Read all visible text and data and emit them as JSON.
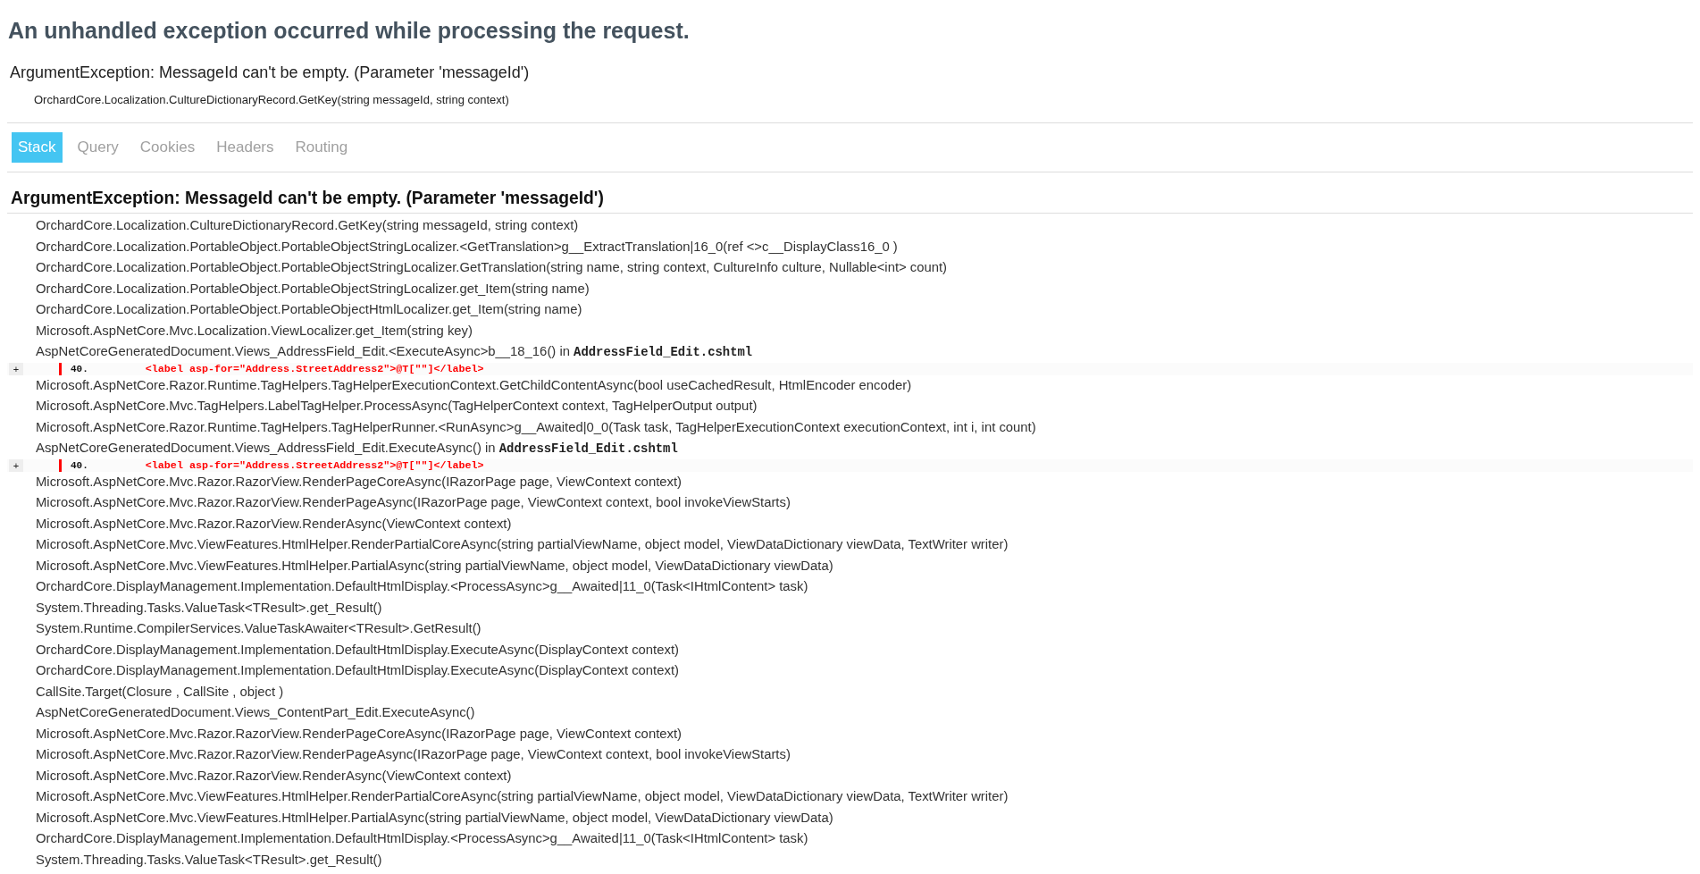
{
  "title": "An unhandled exception occurred while processing the request.",
  "error": {
    "message": "ArgumentException: MessageId can't be empty. (Parameter 'messageId')",
    "location": "OrchardCore.Localization.CultureDictionaryRecord.GetKey(string messageId, string context)"
  },
  "tabs": [
    {
      "label": "Stack",
      "selected": true
    },
    {
      "label": "Query",
      "selected": false
    },
    {
      "label": "Cookies",
      "selected": false
    },
    {
      "label": "Headers",
      "selected": false
    },
    {
      "label": "Routing",
      "selected": false
    }
  ],
  "stack": {
    "heading": "ArgumentException: MessageId can't be empty. (Parameter 'messageId')",
    "frames": [
      {
        "text": "OrchardCore.Localization.CultureDictionaryRecord.GetKey(string messageId, string context)"
      },
      {
        "text": "OrchardCore.Localization.PortableObject.PortableObjectStringLocalizer.<GetTranslation>g__ExtractTranslation|16_0(ref <>c__DisplayClass16_0 )"
      },
      {
        "text": "OrchardCore.Localization.PortableObject.PortableObjectStringLocalizer.GetTranslation(string name, string context, CultureInfo culture, Nullable<int> count)"
      },
      {
        "text": "OrchardCore.Localization.PortableObject.PortableObjectStringLocalizer.get_Item(string name)"
      },
      {
        "text": "OrchardCore.Localization.PortableObject.PortableObjectHtmlLocalizer.get_Item(string name)"
      },
      {
        "text": "Microsoft.AspNetCore.Mvc.Localization.ViewLocalizer.get_Item(string key)"
      },
      {
        "text": "AspNetCoreGeneratedDocument.Views_AddressField_Edit.<ExecuteAsync>b__18_16() in",
        "file": "AddressField_Edit.cshtml",
        "source": {
          "toggle": "+",
          "line_number": "40.",
          "code": "<label asp-for=\"Address.StreetAddress2\">@T[\"\"]</label>"
        }
      },
      {
        "text": "Microsoft.AspNetCore.Razor.Runtime.TagHelpers.TagHelperExecutionContext.GetChildContentAsync(bool useCachedResult, HtmlEncoder encoder)"
      },
      {
        "text": "Microsoft.AspNetCore.Mvc.TagHelpers.LabelTagHelper.ProcessAsync(TagHelperContext context, TagHelperOutput output)"
      },
      {
        "text": "Microsoft.AspNetCore.Razor.Runtime.TagHelpers.TagHelperRunner.<RunAsync>g__Awaited|0_0(Task task, TagHelperExecutionContext executionContext, int i, int count)"
      },
      {
        "text": "AspNetCoreGeneratedDocument.Views_AddressField_Edit.ExecuteAsync() in",
        "file": "AddressField_Edit.cshtml",
        "source": {
          "toggle": "+",
          "line_number": "40.",
          "code": "<label asp-for=\"Address.StreetAddress2\">@T[\"\"]</label>"
        }
      },
      {
        "text": "Microsoft.AspNetCore.Mvc.Razor.RazorView.RenderPageCoreAsync(IRazorPage page, ViewContext context)"
      },
      {
        "text": "Microsoft.AspNetCore.Mvc.Razor.RazorView.RenderPageAsync(IRazorPage page, ViewContext context, bool invokeViewStarts)"
      },
      {
        "text": "Microsoft.AspNetCore.Mvc.Razor.RazorView.RenderAsync(ViewContext context)"
      },
      {
        "text": "Microsoft.AspNetCore.Mvc.ViewFeatures.HtmlHelper.RenderPartialCoreAsync(string partialViewName, object model, ViewDataDictionary viewData, TextWriter writer)"
      },
      {
        "text": "Microsoft.AspNetCore.Mvc.ViewFeatures.HtmlHelper.PartialAsync(string partialViewName, object model, ViewDataDictionary viewData)"
      },
      {
        "text": "OrchardCore.DisplayManagement.Implementation.DefaultHtmlDisplay.<ProcessAsync>g__Awaited|11_0(Task<IHtmlContent> task)"
      },
      {
        "text": "System.Threading.Tasks.ValueTask<TResult>.get_Result()"
      },
      {
        "text": "System.Runtime.CompilerServices.ValueTaskAwaiter<TResult>.GetResult()"
      },
      {
        "text": "OrchardCore.DisplayManagement.Implementation.DefaultHtmlDisplay.ExecuteAsync(DisplayContext context)"
      },
      {
        "text": "OrchardCore.DisplayManagement.Implementation.DefaultHtmlDisplay.ExecuteAsync(DisplayContext context)"
      },
      {
        "text": "CallSite.Target(Closure , CallSite , object )"
      },
      {
        "text": "AspNetCoreGeneratedDocument.Views_ContentPart_Edit.ExecuteAsync()"
      },
      {
        "text": "Microsoft.AspNetCore.Mvc.Razor.RazorView.RenderPageCoreAsync(IRazorPage page, ViewContext context)"
      },
      {
        "text": "Microsoft.AspNetCore.Mvc.Razor.RazorView.RenderPageAsync(IRazorPage page, ViewContext context, bool invokeViewStarts)"
      },
      {
        "text": "Microsoft.AspNetCore.Mvc.Razor.RazorView.RenderAsync(ViewContext context)"
      },
      {
        "text": "Microsoft.AspNetCore.Mvc.ViewFeatures.HtmlHelper.RenderPartialCoreAsync(string partialViewName, object model, ViewDataDictionary viewData, TextWriter writer)"
      },
      {
        "text": "Microsoft.AspNetCore.Mvc.ViewFeatures.HtmlHelper.PartialAsync(string partialViewName, object model, ViewDataDictionary viewData)"
      },
      {
        "text": "OrchardCore.DisplayManagement.Implementation.DefaultHtmlDisplay.<ProcessAsync>g__Awaited|11_0(Task<IHtmlContent> task)"
      },
      {
        "text": "System.Threading.Tasks.ValueTask<TResult>.get_Result()"
      }
    ]
  }
}
